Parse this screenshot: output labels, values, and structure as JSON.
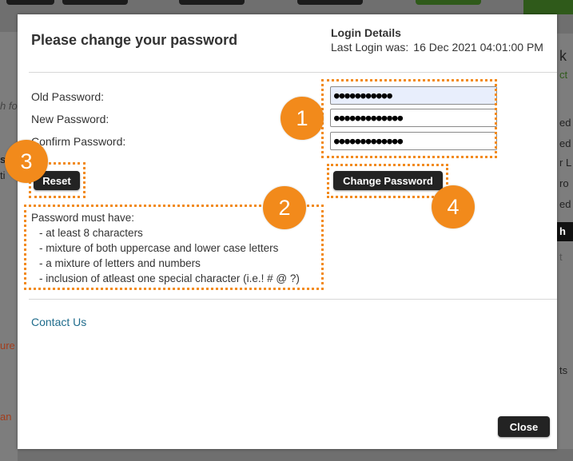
{
  "background": {
    "right_fragments": [
      "k",
      "ct",
      "ed",
      "ed",
      "r L",
      "ro",
      "ed",
      "h",
      "t",
      "ts"
    ],
    "left_fragments": [
      "h fo",
      "s",
      "ti",
      "ure",
      "an"
    ]
  },
  "modal": {
    "title": "Please change your password",
    "login_details": {
      "heading": "Login Details",
      "last_login_label": "Last Login was:",
      "last_login_value": "16 Dec 2021 04:01:00 PM"
    },
    "fields": {
      "old_password": {
        "label": "Old Password:",
        "value": "●●●●●●●●●●●"
      },
      "new_password": {
        "label": "New Password:",
        "value": "●●●●●●●●●●●●●"
      },
      "confirm_password": {
        "label": "Confirm Password:",
        "value": "●●●●●●●●●●●●●"
      }
    },
    "reset_label": "Reset",
    "change_password_label": "Change Password",
    "rules": {
      "heading": "Password must have:",
      "items": [
        "at least 8 characters",
        "mixture of both uppercase and lower case letters",
        "a mixture of letters and numbers",
        "inclusion of atleast one special character (i.e.! # @ ?)"
      ]
    },
    "contact_label": "Contact Us",
    "close_label": "Close"
  },
  "annotations": {
    "accent_color": "#f28a1b",
    "badges": [
      "1",
      "2",
      "3",
      "4"
    ]
  }
}
